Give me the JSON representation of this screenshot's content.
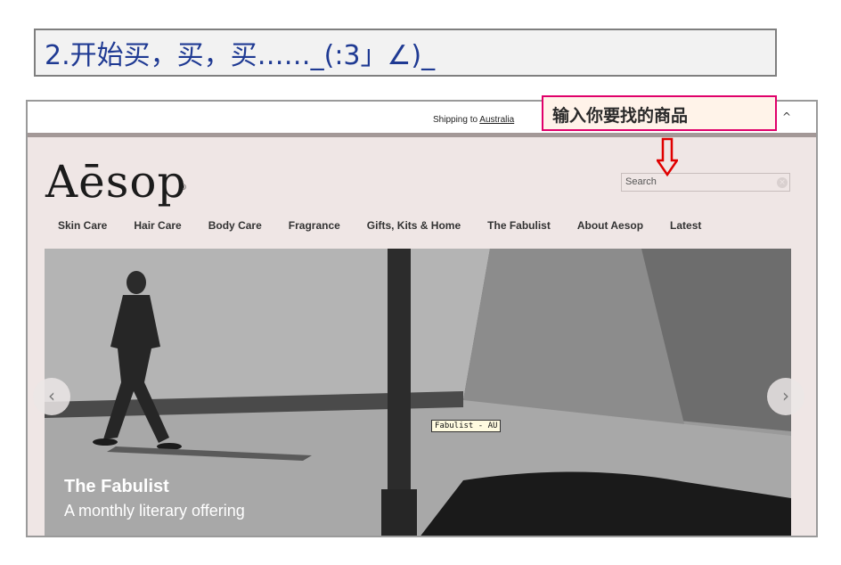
{
  "step": {
    "title": "2.开始买，买，买……_(:3」∠)_"
  },
  "topbar": {
    "shipping_prefix": "Shipping to",
    "shipping_country": "Australia"
  },
  "callout": {
    "text": "输入你要找的商品"
  },
  "site": {
    "logo": "Aēsop",
    "logo_mark": "®",
    "search": {
      "placeholder": "Search"
    },
    "nav": [
      "Skin Care",
      "Hair Care",
      "Body Care",
      "Fragrance",
      "Gifts, Kits & Home",
      "The Fabulist",
      "About Aesop",
      "Latest"
    ]
  },
  "hero": {
    "title": "The Fabulist",
    "subtitle": "A monthly literary offering",
    "tooltip": "Fabulist - AU"
  },
  "colors": {
    "title_text": "#1f3a93",
    "callout_border": "#e0006a",
    "callout_arrow": "#e00000",
    "site_background": "#efe6e5"
  },
  "icons": {
    "prev": "chevron-left-icon",
    "next": "chevron-right-icon",
    "collapse": "caret-up-icon",
    "clear": "clear-search-icon",
    "pointer": "down-arrow-icon"
  }
}
